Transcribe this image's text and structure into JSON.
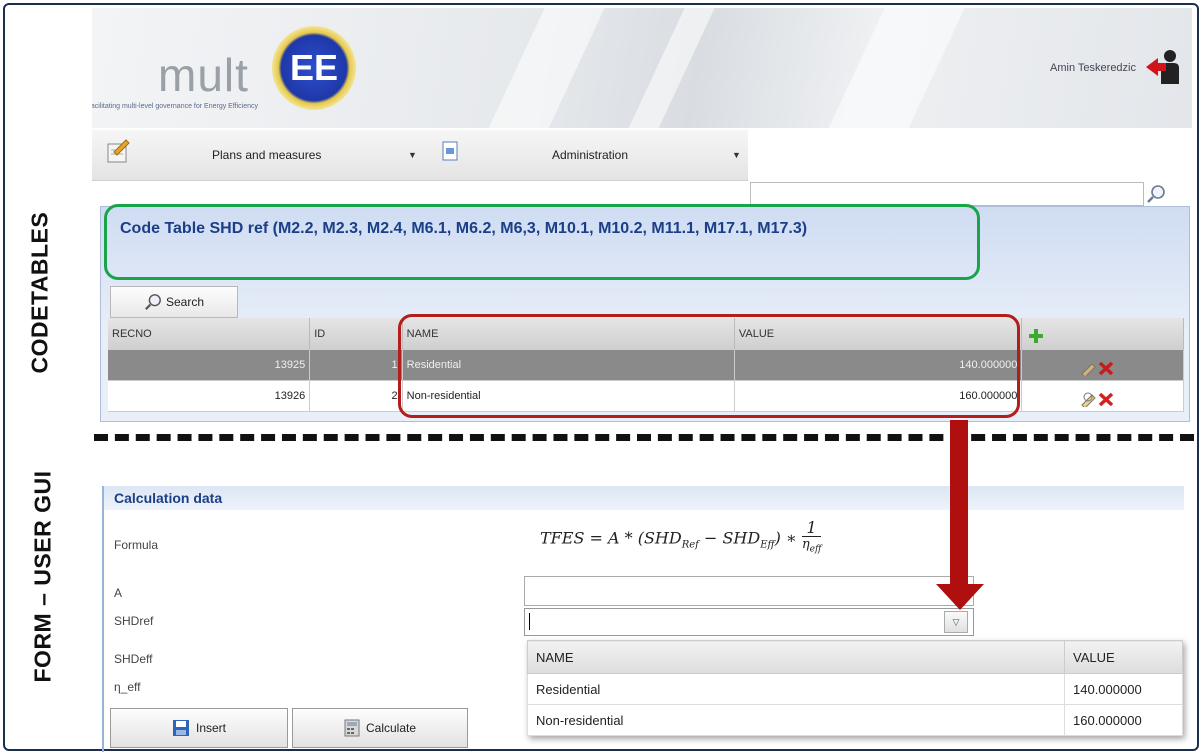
{
  "side_labels": {
    "top": "CODETABLES",
    "bottom": "FORM – USER GUI"
  },
  "header": {
    "logo_text": "mult",
    "logo_mark": "EE",
    "logo_subtitle": "facilitating multi-level governance for Energy Efficiency",
    "user_name": "Amin Teskeredzic"
  },
  "menu": {
    "items": [
      {
        "label": "Plans and measures",
        "icon": "notepad-icon"
      },
      {
        "label": "Administration",
        "icon": "document-icon"
      }
    ]
  },
  "code_table": {
    "title": "Code Table SHD ref (M2.2, M2.3, M2.4, M6.1, M6.2, M6,3, M10.1, M10.2, M11.1, M17.1, M17.3)",
    "search_label": "Search",
    "columns": [
      "RECNO",
      "ID",
      "NAME",
      "VALUE"
    ],
    "rows": [
      {
        "recno": "13925",
        "id": "1",
        "name": "Residential",
        "value": "140.000000",
        "selected": true
      },
      {
        "recno": "13926",
        "id": "2",
        "name": "Non-residential",
        "value": "160.000000",
        "selected": false
      }
    ]
  },
  "form": {
    "section_title": "Calculation data",
    "labels": {
      "formula": "Formula",
      "a": "A",
      "shdref": "SHDref",
      "shdeff": "SHDeff",
      "eta": "η_eff"
    },
    "formula_text": "TFES = A * (SHD",
    "dropdown": {
      "columns": [
        "NAME",
        "VALUE"
      ],
      "rows": [
        {
          "name": "Residential",
          "value": "140.000000"
        },
        {
          "name": "Non-residential",
          "value": "160.000000"
        }
      ]
    },
    "buttons": {
      "insert": "Insert",
      "calculate": "Calculate"
    }
  },
  "colors": {
    "accent_blue": "#1b3f87",
    "green_highlight": "#18a54a",
    "red_highlight": "#b51c1c"
  }
}
